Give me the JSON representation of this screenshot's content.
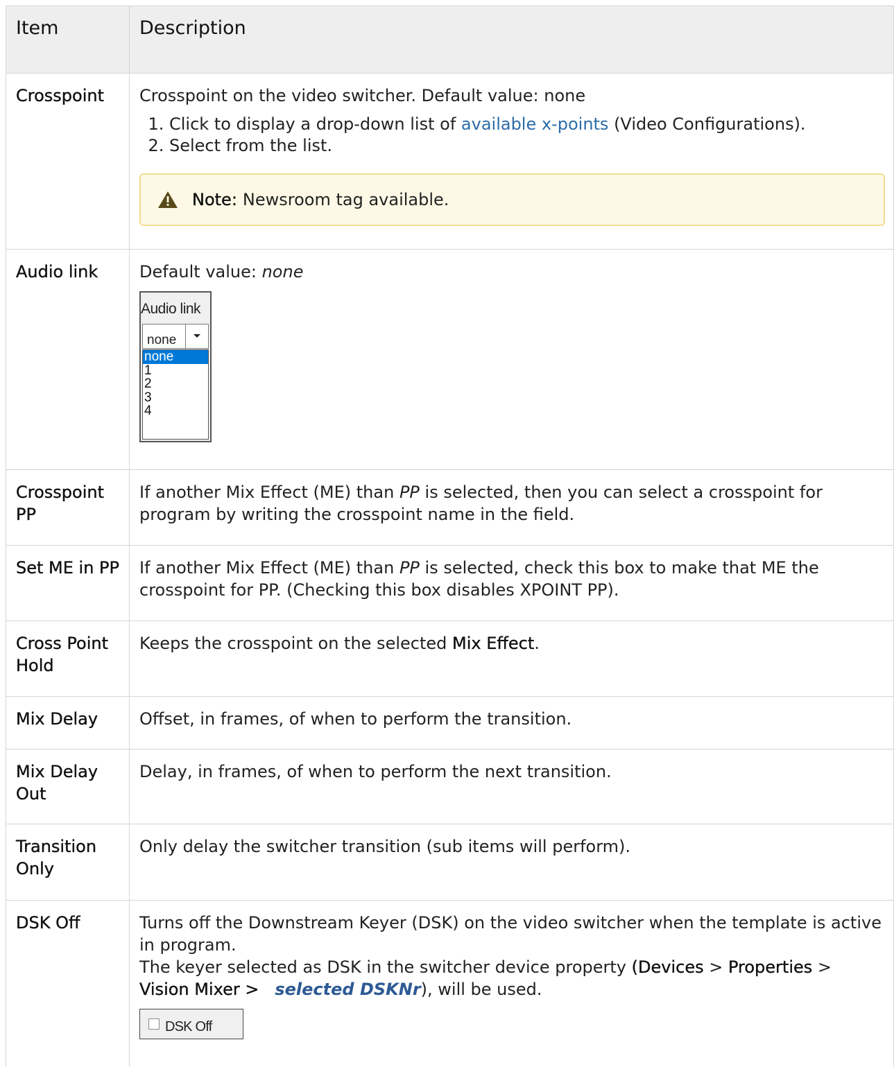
{
  "header": {
    "item": "Item",
    "description": "Description"
  },
  "rows": {
    "crosspoint": {
      "item": "Crosspoint",
      "desc": "Crosspoint on the video switcher. Default value: none",
      "step1_pre": "Click to display a drop-down list of ",
      "step1_link": "available x-points",
      "step1_post": " (Video Configurations).",
      "step2": "Select from the list.",
      "note_label": "Note:",
      "note_text": "Newsroom tag available."
    },
    "audio_link": {
      "item": "Audio link",
      "desc_pre": "Default value: ",
      "desc_value": "none",
      "widget_label": "Audio link",
      "widget_selected": "none",
      "widget_options": [
        "none",
        "1",
        "2",
        "3",
        "4"
      ]
    },
    "crosspoint_pp": {
      "item": "Crosspoint PP",
      "desc_pre": "If another Mix Effect (ME) than ",
      "desc_em": "PP",
      "desc_post": " is selected, then you can select a crosspoint for program by writing the crosspoint name in the field."
    },
    "set_me_pp": {
      "item": "Set ME in PP",
      "desc_pre": "If another Mix Effect (ME) than ",
      "desc_em": "PP",
      "desc_post": " is selected, check this box to make that ME the crosspoint for PP. (Checking this box disables XPOINT PP)."
    },
    "cross_point_hold": {
      "item": "Cross Point Hold",
      "desc_pre": "Keeps the crosspoint on the selected ",
      "desc_bold": "Mix Effect",
      "desc_post": "."
    },
    "mix_delay": {
      "item": "Mix Delay",
      "desc": "Offset, in frames, of when to perform the transition."
    },
    "mix_delay_out": {
      "item": "Mix Delay Out",
      "desc": "Delay, in frames, of when to perform the next transition."
    },
    "transition_only": {
      "item": "Transition Only",
      "desc": "Only delay the switcher transition (sub items will perform)."
    },
    "dsk_off": {
      "item": "DSK Off",
      "desc1": "Turns off the Downstream Keyer (DSK) on the video switcher when the template is active in program.",
      "desc2_pre": "The keyer selected as DSK in the switcher device property ",
      "open_paren": "(",
      "devices": "Devices",
      "sep1": " > ",
      "properties": "Properties",
      "sep2": " > ",
      "vision_mixer": "Vision Mixer > ",
      "selected_dsknr": "selected DSKNr",
      "desc2_post": "), will be used.",
      "widget_label": "DSK Off"
    }
  },
  "colors": {
    "link": "#2d6ca8",
    "note_bg": "#fdf9e6",
    "note_border": "#f3dd91",
    "header_bg": "#eeeeee"
  }
}
